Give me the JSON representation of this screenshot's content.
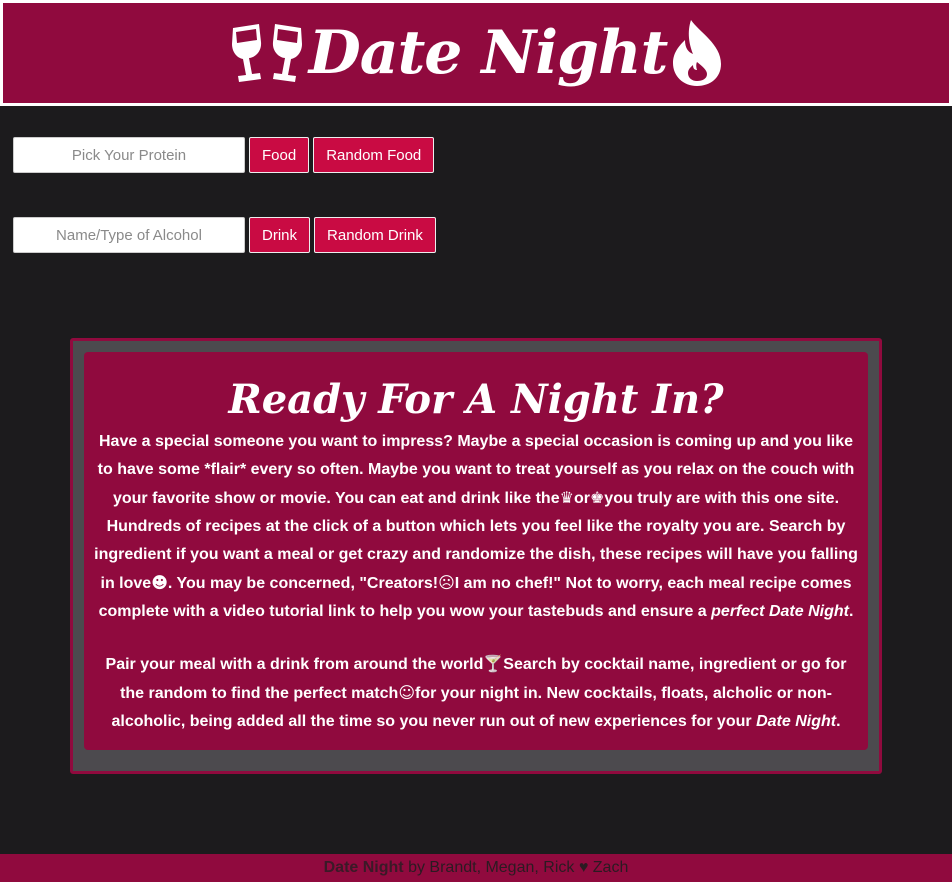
{
  "header": {
    "title": "Date Night",
    "left_icon": "wine-glasses-cheers-icon",
    "right_icon": "flame-icon"
  },
  "food_search": {
    "placeholder": "Pick Your Protein",
    "food_button": "Food",
    "random_button": "Random Food"
  },
  "drink_search": {
    "placeholder": "Name/Type of Alcohol",
    "drink_button": "Drink",
    "random_button": "Random Drink"
  },
  "intro": {
    "title": "Ready For A Night In?",
    "p1": {
      "t1": "Have a special someone you want to impress? Maybe a special occasion is coming up and you like to have some *flair* every so often. Maybe you want to treat yourself as you relax on the couch with your favorite show or movie. You can eat and drink like the",
      "e1": "♛",
      "t2": "or",
      "e2": "♚",
      "t3": "you truly are with this one site. Hundreds of recipes at the click of a button which lets you feel like the royalty you are. Search by ingredient if you want a meal or get crazy and randomize the dish, these recipes will have you falling in love",
      "e3": "☻",
      "t4": ". You may be concerned, \"Creators!",
      "e4": "☹",
      "t5": "I am no chef!\" Not to worry, each meal recipe comes complete with a video tutorial link to help you wow your tastebuds and ensure a",
      "em": "perfect Date Night",
      "t6": "."
    },
    "p2": {
      "t1": "Pair your meal with a drink from around the world",
      "e1": "🍸",
      "t2": "Search by cocktail name, ingredient or go for the random to find the perfect match",
      "e2": "☺",
      "t3": "for your night in. New cocktails, floats, alcholic or non-alcoholic, being added all the time so you never run out of new experiences for your",
      "em": "Date Night",
      "t4": "."
    }
  },
  "footer": {
    "brand": "Date Night",
    "credits": "by Brandt, Megan, Rick",
    "heart": "♥",
    "last": "Zach"
  },
  "colors": {
    "brand": "#900a3e",
    "button": "#c90b43",
    "background": "#1c1b1d",
    "panel": "#4c4a4e"
  }
}
